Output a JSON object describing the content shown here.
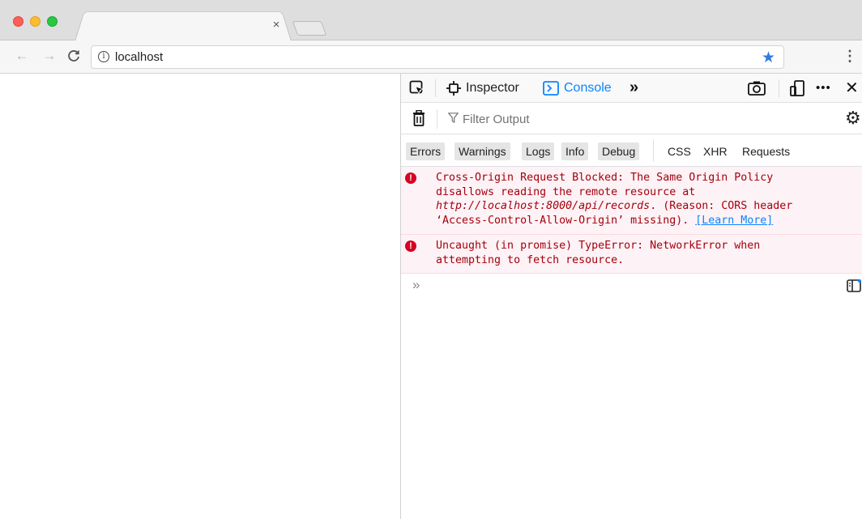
{
  "browser": {
    "tab_close": "×",
    "nav": {
      "back": "←",
      "forward": "→",
      "reload": "C"
    },
    "omnibox": {
      "info": "i",
      "url": "localhost"
    },
    "star": "★",
    "menu": "⋮"
  },
  "devtools": {
    "tabs": {
      "inspector": "Inspector",
      "console": "Console",
      "more": "»"
    },
    "right_icons": {
      "more": "•••",
      "close": "✕"
    },
    "filter": {
      "placeholder": "Filter Output"
    },
    "levels": [
      "Errors",
      "Warnings",
      "Logs",
      "Info",
      "Debug"
    ],
    "network_filters": [
      "CSS",
      "XHR",
      "Requests"
    ],
    "messages": [
      {
        "line1": "Cross-Origin Request Blocked: The Same Origin Policy",
        "line2": "disallows reading the remote resource at",
        "url": "http://localhost:8000/api/records",
        "after_url": ". (Reason: CORS header",
        "line4": "‘Access-Control-Allow-Origin’ missing). ",
        "learn_more": "[Learn More]"
      },
      {
        "line1": "Uncaught (in promise) TypeError: NetworkError when",
        "line2": "attempting to fetch resource."
      }
    ],
    "prompt": "»"
  },
  "colors": {
    "accent": "#0a84ff",
    "error_bg": "#fdf2f5",
    "error_text": "#a4000f",
    "error_icon": "#d70022"
  }
}
